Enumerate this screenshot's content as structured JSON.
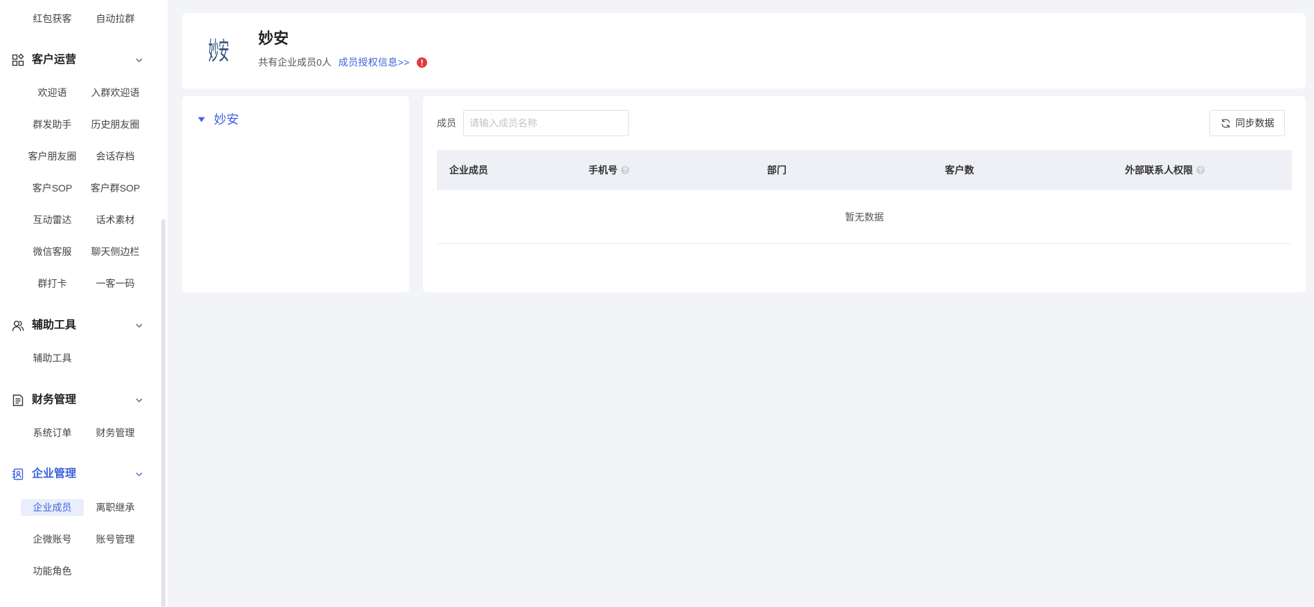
{
  "sidebar": {
    "top_items": [
      "红包获客",
      "自动拉群"
    ],
    "groups": [
      {
        "title": "客户运营",
        "icon": "apps-icon",
        "expanded": true,
        "items": [
          "欢迎语",
          "入群欢迎语",
          "群发助手",
          "历史朋友圈",
          "客户朋友圈",
          "会话存档",
          "客户SOP",
          "客户群SOP",
          "互动雷达",
          "话术素材",
          "微信客服",
          "聊天侧边栏",
          "群打卡",
          "一客一码"
        ]
      },
      {
        "title": "辅助工具",
        "icon": "users-icon",
        "expanded": true,
        "items": [
          "辅助工具"
        ]
      },
      {
        "title": "财务管理",
        "icon": "document-icon",
        "expanded": true,
        "items": [
          "系统订单",
          "财务管理"
        ]
      },
      {
        "title": "企业管理",
        "icon": "contacts-icon",
        "expanded": true,
        "active": true,
        "active_item": "企业成员",
        "items": [
          "企业成员",
          "离职继承",
          "企微账号",
          "账号管理",
          "功能角色"
        ]
      }
    ]
  },
  "header": {
    "logo_text": "妙安",
    "name": "妙安",
    "member_summary": "共有企业成员0人",
    "auth_link": "成员授权信息>>",
    "warning_icon": "exclamation-icon"
  },
  "tree": {
    "root_label": "妙安",
    "icon": "caret-down-icon",
    "expanded": true
  },
  "filter": {
    "label": "成员",
    "placeholder": "请输入成员名称",
    "value": ""
  },
  "sync_button": {
    "label": "同步数据",
    "icon": "refresh-icon"
  },
  "table": {
    "columns": [
      {
        "label": "企业成员",
        "help_icon": false
      },
      {
        "label": "手机号",
        "help_icon": true
      },
      {
        "label": "部门",
        "help_icon": false
      },
      {
        "label": "客户数",
        "help_icon": false
      },
      {
        "label": "外部联系人权限",
        "help_icon": true
      }
    ],
    "rows": [],
    "empty_text": "暂无数据"
  },
  "colors": {
    "primary": "#3d63dd",
    "page_bg": "#f3f4f8",
    "active_bg": "#e9eefc",
    "table_header_bg": "#eef0f5",
    "warning": "#e4393c"
  }
}
